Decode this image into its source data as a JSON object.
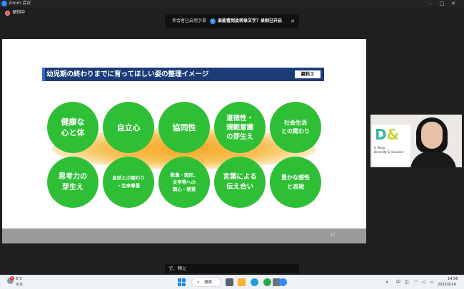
{
  "window": {
    "title": "Zoom 会议",
    "minimize": "–",
    "maximize": "□",
    "close": "✕"
  },
  "recording": {
    "label": "录制中"
  },
  "caption_notice": {
    "text": "参会者已启用字幕",
    "link_text": "谁能看到此转录文字？录制已开启",
    "close": "✕"
  },
  "slide": {
    "title": "幼児期の終わりまでに育ってほしい姿の整理イメージ",
    "tag": "資料２",
    "page_number": "17",
    "bubbles": [
      {
        "label": "健康な\n心と体"
      },
      {
        "label": "自立心"
      },
      {
        "label": "協同性"
      },
      {
        "label": "道徳性・\n規範意識\nの芽生え"
      },
      {
        "label": "社会生活\nとの関わり"
      },
      {
        "label": "思考力の\n芽生え"
      },
      {
        "label": "自然との関わり\n・生命尊重"
      },
      {
        "label": "数量・図形、\n文字等への\n関心・感覚"
      },
      {
        "label": "言葉による\n伝え合い"
      },
      {
        "label": "豊かな感性\nと表現"
      }
    ]
  },
  "video_tile": {
    "logo_text": "D&",
    "org_line1": "U Tokyo",
    "org_line2": "Diversity & Inclusion"
  },
  "subtitle": {
    "text": "で、特に"
  },
  "taskbar": {
    "weather_temp": "6°C",
    "weather_condition": "多云",
    "weather_badge": "1",
    "search_label": "搜索",
    "tray_lang": "中",
    "time": "14:56",
    "date": "2023/2/24"
  },
  "colors": {
    "bubble_green": "#2fbf36",
    "header_navy": "#1c3c78",
    "glow_orange": "#f6a623",
    "recording_red": "#e5534b"
  },
  "icons": [
    "zoom-logo-icon",
    "recording-icon",
    "captions-info-icon",
    "close-icon",
    "weather-icon",
    "windows-start-icon",
    "search-icon",
    "taskbar-app-icons",
    "wifi-icon",
    "volume-icon",
    "battery-icon"
  ]
}
